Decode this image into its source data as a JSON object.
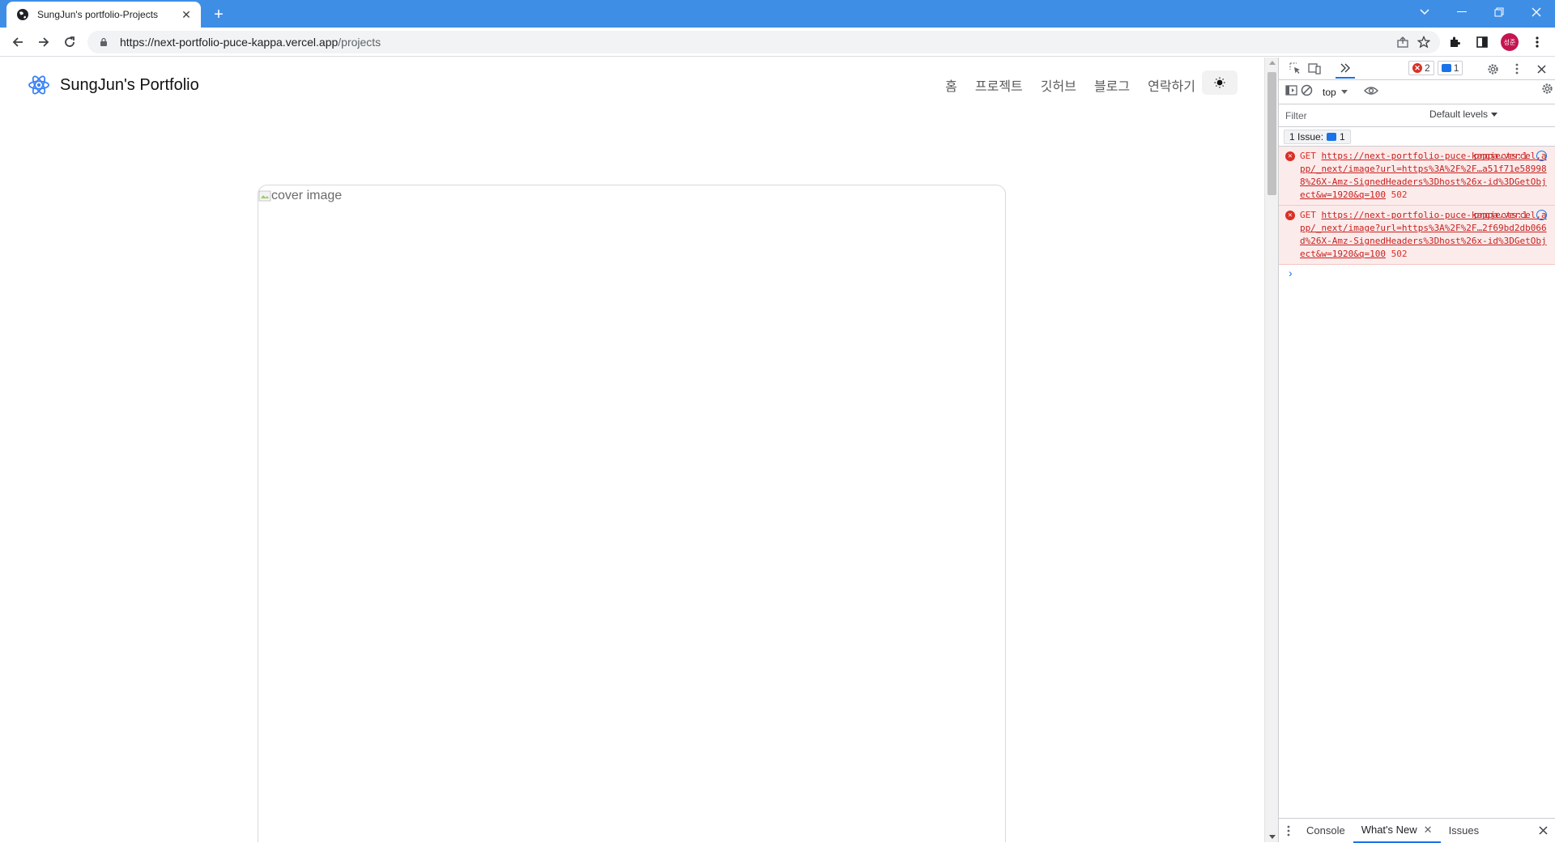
{
  "browser": {
    "tab_title": "SungJun's portfolio-Projects",
    "url_host": "https://next-portfolio-puce-kappa.vercel.app",
    "url_path": "/projects",
    "avatar_text": "성준"
  },
  "site": {
    "brand": "SungJun's Portfolio",
    "nav": [
      "홈",
      "프로젝트",
      "깃허브",
      "블로그",
      "연락하기"
    ],
    "cover_alt": "cover image",
    "accent": "#3b82f6"
  },
  "devtools": {
    "error_count": "2",
    "info_count": "1",
    "context": "top",
    "filter_placeholder": "Filter",
    "levels": "Default levels",
    "issues_label": "1 Issue:",
    "issues_count": "1",
    "errors": [
      {
        "method": "GET",
        "url": "https://next-portfolio-puce-kappa.vercel.app/_next/image?url=https%3A%2F%2F…a51f71e589988%26X-Amz-SignedHeaders%3Dhost%26x-id%3DGetObject&w=1920&q=100",
        "source": "projects:1",
        "status": "502"
      },
      {
        "method": "GET",
        "url": "https://next-portfolio-puce-kappa.vercel.app/_next/image?url=https%3A%2F%2F…2f69bd2db066d%26X-Amz-SignedHeaders%3Dhost%26x-id%3DGetObject&w=1920&q=100",
        "source": "projects:1",
        "status": "502"
      }
    ],
    "drawer_tabs": [
      "Console",
      "What's New",
      "Issues"
    ]
  }
}
